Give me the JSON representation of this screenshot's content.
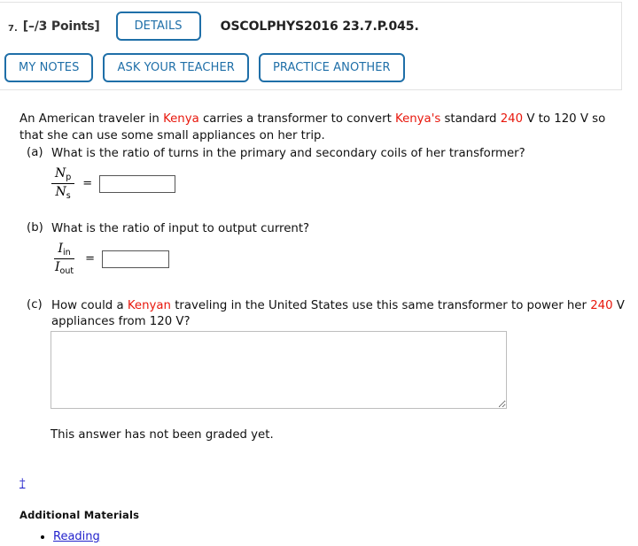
{
  "header": {
    "question_number": "7.",
    "points": "[–/3 Points]",
    "details_button": "DETAILS",
    "question_code": "OSCOLPHYS2016 23.7.P.045.",
    "buttons": [
      {
        "label": "MY NOTES",
        "name": "my-notes-button"
      },
      {
        "label": "ASK YOUR TEACHER",
        "name": "ask-your-teacher-button"
      },
      {
        "label": "PRACTICE ANOTHER",
        "name": "practice-another-button"
      }
    ],
    "accent_color": "#1f6fa8"
  },
  "problem": {
    "intro": {
      "seg1": "An American traveler in ",
      "hl1": "Kenya",
      "seg2": " carries a transformer to convert ",
      "hl2": "Kenya's",
      "seg3": " standard ",
      "hl3": "240",
      "seg4": " V to 120 V so that she can use some small appliances on her trip."
    },
    "highlight_color": "#e8170c",
    "parts": [
      {
        "label": "(a)",
        "text": "What is the ratio of turns in the primary and secondary coils of her transformer?",
        "numerator_var": "N",
        "numerator_sub": "p",
        "denominator_var": "N",
        "denominator_sub": "s",
        "equals": "=",
        "answer_value": "",
        "answer_placeholder": ""
      },
      {
        "label": "(b)",
        "text": "What is the ratio of input to output current?",
        "numerator_var": "I",
        "numerator_sub": "in",
        "denominator_var": "I",
        "denominator_sub": "out",
        "equals": "=",
        "answer_value": "",
        "answer_placeholder": ""
      }
    ],
    "part_c": {
      "label": "(c)",
      "seg1": "How could a ",
      "hl1": "Kenyan",
      "seg2": " traveling in the United States use this same transformer to power her ",
      "hl2": "240",
      "seg3": " V appliances from 120 V?",
      "essay_value": "",
      "essay_placeholder": "",
      "graded_note": "This answer has not been graded yet."
    }
  },
  "footer": {
    "dagger": "†",
    "additional_materials_heading": "Additional Materials",
    "materials": [
      {
        "label": "Reading"
      }
    ],
    "link_color": "#2222cc"
  }
}
